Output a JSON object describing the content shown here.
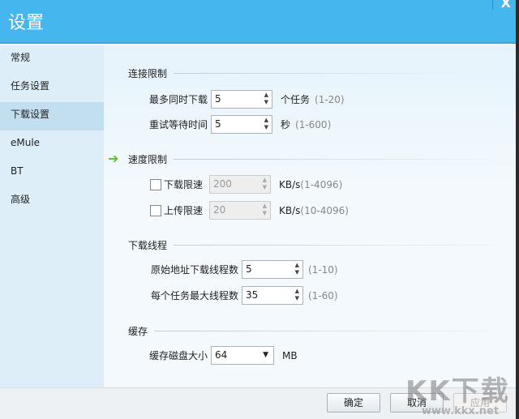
{
  "window": {
    "title": "设置",
    "close": "X"
  },
  "sidebar": {
    "items": [
      {
        "label": "常规"
      },
      {
        "label": "任务设置"
      },
      {
        "label": "下载设置",
        "selected": true
      },
      {
        "label": "eMule"
      },
      {
        "label": "BT"
      },
      {
        "label": "高级"
      }
    ]
  },
  "connection": {
    "title": "连接限制",
    "max_downloads": {
      "label": "最多同时下载",
      "value": "5",
      "unit": "个任务",
      "range": "(1-20)"
    },
    "retry_wait": {
      "label": "重试等待时间",
      "value": "5",
      "unit": "秒",
      "range": "(1-600)"
    }
  },
  "speed": {
    "title": "速度限制",
    "download": {
      "label": "下载限速",
      "checked": false,
      "value": "200",
      "unit": "KB/s",
      "range": "(1-4096)"
    },
    "upload": {
      "label": "上传限速",
      "checked": false,
      "value": "20",
      "unit": "KB/s",
      "range": "(10-4096)"
    }
  },
  "threads": {
    "title": "下载线程",
    "origin": {
      "label": "原始地址下载线程数",
      "value": "5",
      "range": "(1-10)"
    },
    "per_task": {
      "label": "每个任务最大线程数",
      "value": "35",
      "range": "(1-60)"
    }
  },
  "cache": {
    "title": "缓存",
    "size": {
      "label": "缓存磁盘大小",
      "value": "64",
      "unit": "MB"
    }
  },
  "footer": {
    "ok": "确定",
    "cancel": "取消",
    "apply": "应用"
  },
  "watermark": {
    "logo": "KK下载",
    "url": "www.kkx.net"
  }
}
